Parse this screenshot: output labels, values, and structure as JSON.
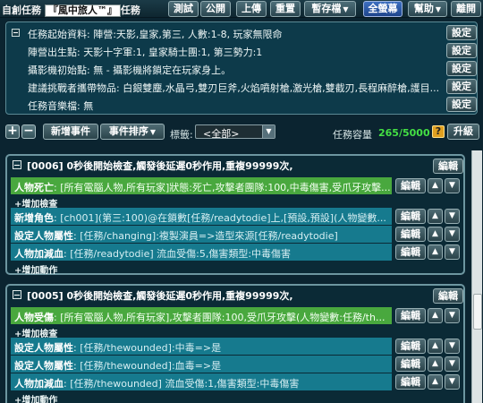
{
  "toolbar": {
    "app_label": "自創任務",
    "app_name": "『風中旅人™』",
    "app_suffix": "任務",
    "test": "測試",
    "public": "公開",
    "upload": "上傳",
    "reset": "重置",
    "temp_save": "暫存檔",
    "full_close": "全螢幕",
    "help": "幫助",
    "leave": "離開"
  },
  "settings": {
    "set_button": "設定",
    "rows": [
      "任務起始資料: 陣營:天影,皇家,第三, 人數:1-8, 玩家無限命",
      "陣營出生點: 天影十字軍:1, 皇家騎士團:1, 第三勢力:1",
      "攝影機初始點: 無 - 攝影機將鎖定在玩家身上。",
      "建議挑戰者攜帶物品: 白銀雙塵,水晶弓,雙刃巨斧,火焰噴射槍,激光槍,雙截刃,長程麻醉槍,護目...",
      "任務音樂檔: 無"
    ]
  },
  "event_toolbar": {
    "plus": "+",
    "minus": "−",
    "add_event": "新增事件",
    "sort_event": "事件排序",
    "tag_label": "標籤:",
    "tag_value": "<全部>",
    "capacity_label": "任務容量",
    "capacity_value": "265/5000",
    "help_q": "?",
    "upgrade": "升級"
  },
  "events": [
    {
      "title": "[0006] 0秒後開始檢查,觸發後延遲0秒作用,重複99999次,",
      "edit": "編輯",
      "trigger": {
        "label": "人物死亡",
        "text": "[所有電腦人物,所有玩家]狀態:死亡,攻擊者團隊:100,中毒傷害,受爪牙攻擊..."
      },
      "add_check": "增加檢查",
      "actions": [
        {
          "label": "新增角色",
          "text": "[ch001](第三:100)@在鎖數[任務/readytodie]上,[預設,預設](人物變數..."
        },
        {
          "label": "設定人物屬性",
          "text": "[任務/changing]:複製演員=>造型來源[任務/readytodie]"
        },
        {
          "label": "人物加減血",
          "text": "[任務/readytodie] 流血受傷:5,傷害類型:中毒傷害"
        }
      ],
      "add_action": "增加動作"
    },
    {
      "title": "[0005] 0秒後開始檢查,觸發後延遲0秒作用,重複99999次,",
      "edit": "編輯",
      "trigger": {
        "label": "人物受傷",
        "text": "[所有電腦人物,所有玩家],攻擊者團隊:100,受爪牙攻擊(人物變數:任務/th..."
      },
      "add_check": "增加檢查",
      "actions": [
        {
          "label": "設定人物屬性",
          "text": "[任務/thewounded]:中毒=>是"
        },
        {
          "label": "設定人物屬性",
          "text": "[任務/thewounded]:血毒=>是"
        },
        {
          "label": "人物加減血",
          "text": "[任務/thewounded] 流血受傷:1,傷害類型:中毒傷害"
        }
      ],
      "add_action": "增加動作"
    }
  ],
  "icons": {
    "up": "▲",
    "down": "▼",
    "dropdown": "▼",
    "plus": "+"
  }
}
